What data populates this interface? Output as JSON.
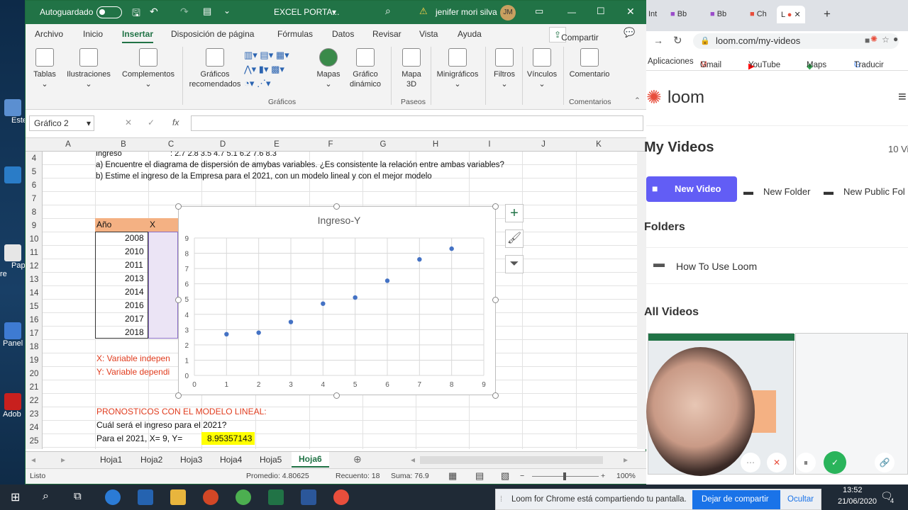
{
  "excel": {
    "autosave_label": "Autoguardado",
    "doc_title": "EXCEL PORTA...",
    "user_name": "jenifer mori silva",
    "user_initials": "JM",
    "tabs": [
      "Archivo",
      "Inicio",
      "Insertar",
      "Disposición de página",
      "Fórmulas",
      "Datos",
      "Revisar",
      "Vista",
      "Ayuda"
    ],
    "share_label": "Compartir",
    "ribbon": {
      "tablas": "Tablas",
      "ilustraciones": "Ilustraciones",
      "complementos": "Complementos",
      "graficos_recomendados": "Gráficos recomendados",
      "mapas": "Mapas",
      "grafico_dinamico": "Gráfico dinámico",
      "mapa3d": "Mapa 3D",
      "minigraficos": "Minigráficos",
      "filtros": "Filtros",
      "vinculos": "Vínculos",
      "comentario": "Comentario",
      "group_graficos": "Gráficos",
      "group_paseos": "Paseos",
      "group_comentarios": "Comentarios"
    },
    "namebox": "Gráfico 2",
    "fx_label": "fx",
    "columns": [
      "A",
      "B",
      "C",
      "D",
      "E",
      "F",
      "G",
      "H",
      "I",
      "J",
      "K"
    ],
    "rows": [
      "4",
      "5",
      "6",
      "7",
      "8",
      "9",
      "10",
      "11",
      "12",
      "13",
      "14",
      "15",
      "16",
      "17",
      "18",
      "19",
      "20",
      "21",
      "22",
      "23",
      "24",
      "25"
    ],
    "cells": {
      "r4_b": "Ingreso",
      "r4_c": ":  2.7    2.8    3.5    4.7    5.1    6.2    7.6    8.3",
      "r4_line": "a)     Encuentre el diagrama de dispersión de amybas variables. ¿Es consistente la relación entre ambas variables?",
      "r5_line": "b)     Estime el ingreso de la Empresa para el 2021, con un modelo lineal y con el mejor modelo",
      "hdr_anio": "Año",
      "hdr_x": "X",
      "years": [
        "2008",
        "2010",
        "2011",
        "2013",
        "2014",
        "2016",
        "2017",
        "2018"
      ],
      "r19": "X: Variable indepen",
      "r20": "Y: Variable dependi",
      "r23": "PRONOSTICOS CON EL MODELO LINEAL:",
      "r24": "Cuál será el ingreso para el 2021?",
      "r25": "Para el 2021, X= 9, Y=",
      "r25_value": "8.95357143"
    },
    "sheets": [
      "Hoja1",
      "Hoja2",
      "Hoja3",
      "Hoja4",
      "Hoja5",
      "Hoja6"
    ],
    "active_sheet": "Hoja6",
    "status": {
      "mode": "Listo",
      "promedio": "Promedio: 4.80625",
      "recuento": "Recuento: 18",
      "suma": "Suma: 76.9",
      "zoom": "100%"
    }
  },
  "chart_data": {
    "type": "scatter",
    "title": "Ingreso-Y",
    "x": [
      1,
      2,
      3,
      4,
      5,
      6,
      7,
      8
    ],
    "y": [
      2.7,
      2.8,
      3.5,
      4.7,
      5.1,
      6.2,
      7.6,
      8.3
    ],
    "xlim": [
      0,
      9
    ],
    "ylim": [
      0,
      9
    ],
    "xticks": [
      "0",
      "1",
      "2",
      "3",
      "4",
      "5",
      "6",
      "7",
      "8",
      "9"
    ],
    "yticks": [
      "0",
      "1",
      "2",
      "3",
      "4",
      "5",
      "6",
      "7",
      "8",
      "9"
    ],
    "grid": true,
    "color": "#4472c4"
  },
  "chrome": {
    "tabs": [
      "Int",
      "Bb",
      "Bb",
      "Ch",
      "L"
    ],
    "url": "loom.com/my-videos",
    "bookmarks": [
      "Aplicaciones",
      "Gmail",
      "YouTube",
      "Maps",
      "Traducir"
    ],
    "brand": "loom",
    "page_title": "My Videos",
    "video_count": "10 Vi",
    "new_video": "New Video",
    "new_folder": "New Folder",
    "new_public_folder": "New Public Fol",
    "folders_heading": "Folders",
    "folder_item": "How To Use Loom",
    "all_videos_heading": "All Videos"
  },
  "desktop": {
    "icons": [
      "Este",
      "Pap re",
      "Panel",
      "Adob"
    ]
  },
  "taskbar": {
    "share_message": "Loom for Chrome está compartiendo tu pantalla.",
    "stop_sharing": "Dejar de compartir",
    "hide": "Ocultar",
    "time": "13:52",
    "date": "21/06/2020",
    "notif_count": "4"
  }
}
